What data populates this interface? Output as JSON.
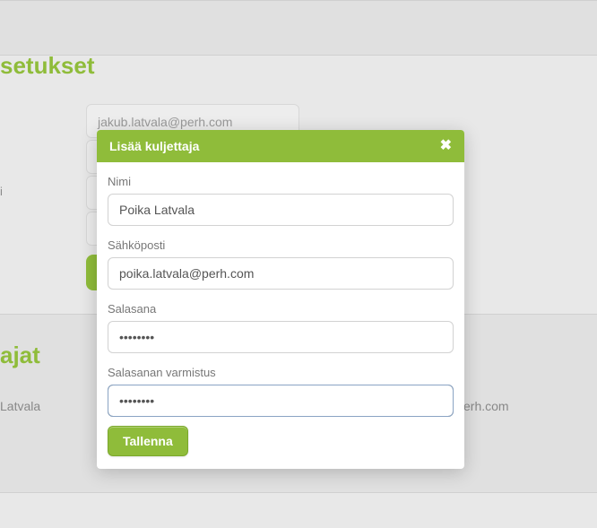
{
  "background": {
    "section1_title": "setukset",
    "email_value": "jakub.latvala@perh.com",
    "label_partial": "i",
    "section2_title": "ajat",
    "row_name": "Latvala",
    "row_email": "@perh.com"
  },
  "modal": {
    "title": "Lisää kuljettaja",
    "close_icon": "✖",
    "fields": {
      "name_label": "Nimi",
      "name_value": "Poika Latvala",
      "email_label": "Sähköposti",
      "email_value": "poika.latvala@perh.com",
      "password_label": "Salasana",
      "password_value": "••••••••",
      "confirm_label": "Salasanan varmistus",
      "confirm_value": "••••••••"
    },
    "save_label": "Tallenna"
  }
}
